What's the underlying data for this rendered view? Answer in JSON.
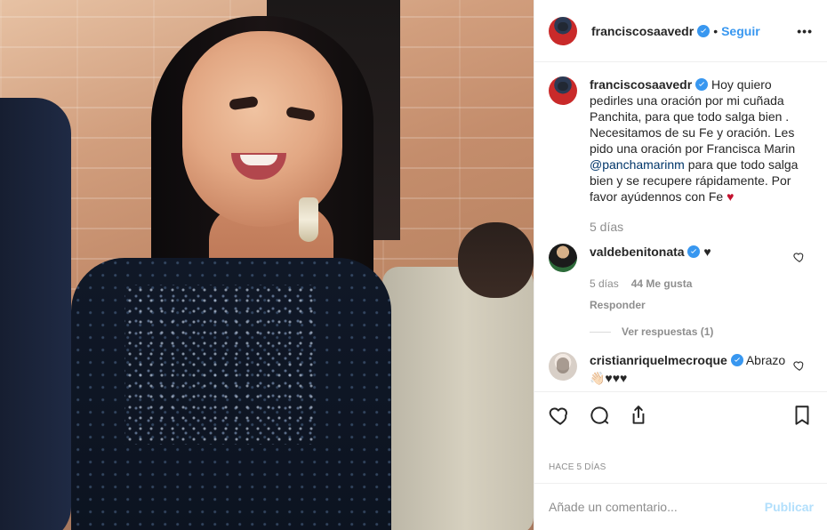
{
  "post": {
    "owner": {
      "username": "franciscosaavedr",
      "verified": true
    },
    "follow_label": "Seguir",
    "dot": "•",
    "menu_label": "•••"
  },
  "caption": {
    "username": "franciscosaavedr",
    "text_before_mention": "Hoy quiero pedirles una oración por mi cuñada Panchita, para que todo salga bien . Necesitamos de su Fe y oración. Les pido una oración por Francisca Marin",
    "mention": "@panchamarinm",
    "text_after_mention": "para que todo salga bien y se recupere rápidamente. Por favor ayúdennos con Fe",
    "heart": "♥",
    "time": "5 días"
  },
  "comments": [
    {
      "username": "valdebenitonata",
      "verified": true,
      "text": "♥",
      "time": "5 días",
      "likes": "44 Me gusta",
      "reply_label": "Responder",
      "view_replies": "Ver respuestas (1)"
    },
    {
      "username": "cristianriquelmecroque",
      "verified": true,
      "text": "Abrazo",
      "emoji": "👋🏻♥♥♥"
    }
  ],
  "actions": {
    "like_icon": "heart-outline",
    "comment_icon": "comment-outline",
    "share_icon": "share-outline",
    "save_icon": "bookmark-outline"
  },
  "timestamp": "HACE 5 DÍAS",
  "add_comment": {
    "placeholder": "Añade un comentario...",
    "publish_label": "Publicar"
  },
  "colors": {
    "accent": "#3897f0",
    "text": "#262626",
    "muted": "#8e8e8e",
    "border": "#efefef",
    "publish_disabled": "#b2dffc",
    "heart_red": "#c4122f"
  }
}
